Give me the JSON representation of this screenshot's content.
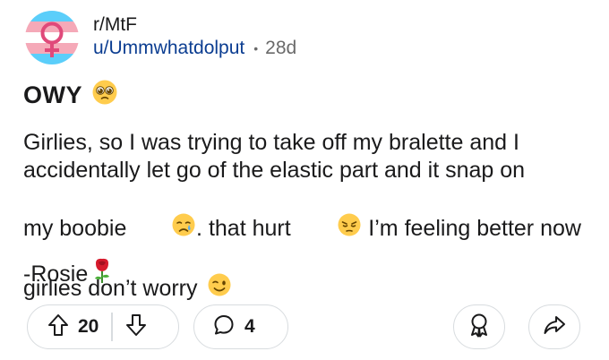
{
  "post": {
    "community": "r/MtF",
    "username": "u/Ummwhatdolput",
    "separator": "•",
    "age": "28d",
    "title": "OWY",
    "body_lines": [
      "Girlies, so I was trying to take off my bralette and I",
      "accidentally let go of the elastic part and it snap on",
      "my boobie",
      ". that hurt",
      " I’m feeling better now",
      "girlies don’t worry"
    ],
    "signoff": "-Rosie"
  },
  "actions": {
    "upvotes": "20",
    "comments": "4"
  },
  "colors": {
    "flag_blue": "#5bcefa",
    "flag_pink": "#f5a9b8",
    "flag_white": "#ffffff",
    "symbol": "#e0497a",
    "username": "#0b3d91",
    "muted": "#6a6a6a",
    "border": "#d8dcdf"
  },
  "icons": {
    "avatar": "trans-flag-symbol-avatar",
    "title_emoji": "pleading-face-emoji",
    "crying_emoji": "crying-face-emoji",
    "pensive_emoji": "pensive-face-emoji",
    "wink_emoji": "winking-face-emoji",
    "rose_emoji": "rose-emoji"
  }
}
